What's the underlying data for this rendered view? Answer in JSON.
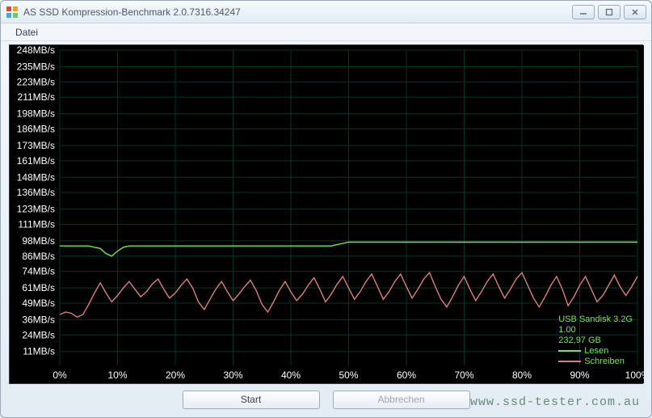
{
  "window": {
    "title": "AS SSD Kompression-Benchmark 2.0.7316.34247"
  },
  "menu": {
    "datei": "Datei"
  },
  "buttons": {
    "start": "Start",
    "cancel": "Abbrechen"
  },
  "info": {
    "device": "USB Sandisk 3.2G",
    "fw": "1.00",
    "capacity": "232,97 GB",
    "read_label": "Lesen",
    "write_label": "Schreiben"
  },
  "watermark": "www.ssd-tester.com.au",
  "chart_data": {
    "type": "line",
    "xlabel": "",
    "ylabel": "",
    "xlim": [
      0,
      100
    ],
    "ylim": [
      0,
      248
    ],
    "x_ticks": [
      "0%",
      "10%",
      "20%",
      "30%",
      "40%",
      "50%",
      "60%",
      "70%",
      "80%",
      "90%",
      "100%"
    ],
    "y_ticks": [
      "248MB/s",
      "235MB/s",
      "223MB/s",
      "211MB/s",
      "198MB/s",
      "186MB/s",
      "173MB/s",
      "161MB/s",
      "148MB/s",
      "136MB/s",
      "123MB/s",
      "111MB/s",
      "98MB/s",
      "86MB/s",
      "74MB/s",
      "61MB/s",
      "49MB/s",
      "36MB/s",
      "24MB/s",
      "11MB/s"
    ],
    "x": [
      0,
      1,
      2,
      3,
      4,
      5,
      6,
      7,
      8,
      9,
      10,
      11,
      12,
      13,
      14,
      15,
      16,
      17,
      18,
      19,
      20,
      21,
      22,
      23,
      24,
      25,
      26,
      27,
      28,
      29,
      30,
      31,
      32,
      33,
      34,
      35,
      36,
      37,
      38,
      39,
      40,
      41,
      42,
      43,
      44,
      45,
      46,
      47,
      48,
      49,
      50,
      51,
      52,
      53,
      54,
      55,
      56,
      57,
      58,
      59,
      60,
      61,
      62,
      63,
      64,
      65,
      66,
      67,
      68,
      69,
      70,
      71,
      72,
      73,
      74,
      75,
      76,
      77,
      78,
      79,
      80,
      81,
      82,
      83,
      84,
      85,
      86,
      87,
      88,
      89,
      90,
      91,
      92,
      93,
      94,
      95,
      96,
      97,
      98,
      99,
      100
    ],
    "series": [
      {
        "name": "Lesen",
        "color": "#74e852",
        "values": [
          94,
          94,
          94,
          94,
          94,
          94,
          93,
          92,
          88,
          86,
          90,
          93,
          94,
          94,
          94,
          94,
          94,
          94,
          94,
          94,
          94,
          94,
          94,
          94,
          94,
          94,
          94,
          94,
          94,
          94,
          94,
          94,
          94,
          94,
          94,
          94,
          94,
          94,
          94,
          94,
          94,
          94,
          94,
          94,
          94,
          94,
          94,
          94,
          95,
          96,
          97,
          97,
          97,
          97,
          97,
          97,
          97,
          97,
          97,
          97,
          97,
          97,
          97,
          97,
          97,
          97,
          97,
          97,
          97,
          97,
          97,
          97,
          97,
          97,
          97,
          97,
          97,
          97,
          97,
          97,
          97,
          97,
          97,
          97,
          97,
          97,
          97,
          97,
          97,
          97,
          97,
          97,
          97,
          97,
          97,
          97,
          97,
          97,
          97,
          97,
          97
        ]
      },
      {
        "name": "Schreiben",
        "color": "#d97f7f",
        "values": [
          40,
          42,
          41,
          38,
          40,
          48,
          57,
          65,
          57,
          50,
          55,
          61,
          66,
          60,
          54,
          58,
          64,
          68,
          60,
          53,
          57,
          63,
          68,
          61,
          50,
          44,
          52,
          60,
          66,
          58,
          51,
          56,
          62,
          67,
          59,
          48,
          42,
          50,
          59,
          66,
          58,
          51,
          56,
          63,
          69,
          60,
          50,
          56,
          64,
          70,
          61,
          52,
          58,
          66,
          72,
          62,
          52,
          58,
          66,
          72,
          62,
          53,
          60,
          68,
          73,
          62,
          52,
          46,
          54,
          63,
          70,
          60,
          51,
          58,
          66,
          72,
          62,
          53,
          60,
          68,
          73,
          63,
          53,
          46,
          54,
          63,
          70,
          60,
          47,
          54,
          63,
          70,
          60,
          50,
          55,
          63,
          71,
          62,
          55,
          62,
          70
        ]
      }
    ]
  }
}
